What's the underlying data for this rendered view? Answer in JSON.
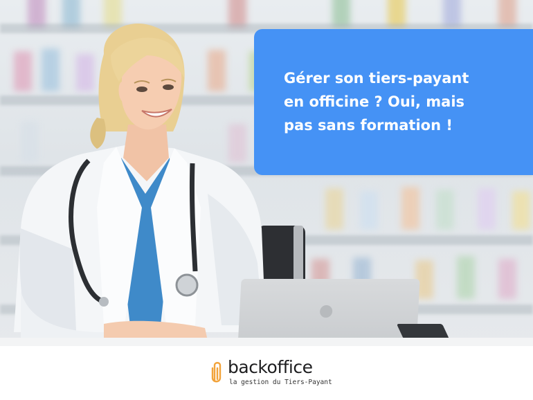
{
  "banner": {
    "headline_lines": [
      "Gérer son tiers-payant",
      "en officine ? Oui, mais",
      "pas sans formation !"
    ],
    "background_color": "#4592f5"
  },
  "logo": {
    "name": "backoffice",
    "tagline": "la gestion du Tiers-Payant",
    "accent_color": "#f2a33a",
    "icon": "paperclip-logo-icon"
  },
  "photo": {
    "subject": "pharmacist-photo"
  }
}
